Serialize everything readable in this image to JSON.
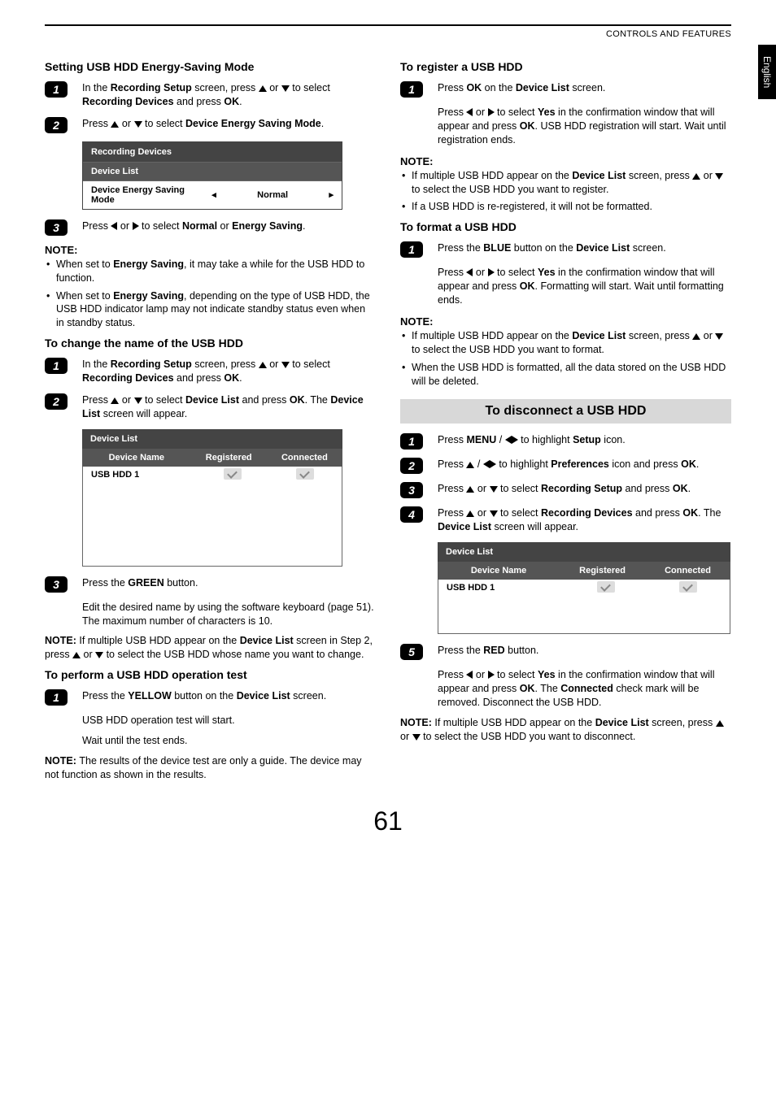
{
  "header": {
    "section": "CONTROLS AND FEATURES",
    "language_tab": "English",
    "page_number": "61"
  },
  "left": {
    "s1_title": "Setting USB HDD Energy-Saving Mode",
    "s1_step1_a": "In the ",
    "s1_step1_b": "Recording Setup",
    "s1_step1_c": " screen, press ",
    "s1_step1_d": " or ",
    "s1_step1_e": " to select ",
    "s1_step1_f": "Recording Devices",
    "s1_step1_g": " and press ",
    "s1_step1_h": "OK",
    "s1_step1_i": ".",
    "s1_step2_a": "Press ",
    "s1_step2_b": " or ",
    "s1_step2_c": " to select ",
    "s1_step2_d": "Device Energy Saving Mode",
    "s1_step2_e": ".",
    "osd1": {
      "title": "Recording Devices",
      "row1": "Device List",
      "row2_name": "Device Energy Saving Mode",
      "row2_value": "Normal"
    },
    "s1_step3_a": "Press ",
    "s1_step3_b": " or ",
    "s1_step3_c": " to select ",
    "s1_step3_d": "Normal",
    "s1_step3_e": " or ",
    "s1_step3_f": "Energy Saving",
    "s1_step3_g": ".",
    "s1_note_title": "NOTE:",
    "s1_note1_a": "When set to ",
    "s1_note1_b": "Energy Saving",
    "s1_note1_c": ", it may take a while for the USB HDD to function.",
    "s1_note2_a": "When set to ",
    "s1_note2_b": "Energy Saving",
    "s1_note2_c": ", depending on the type of USB HDD, the USB HDD indicator lamp may not indicate standby status even when in standby status.",
    "s2_title": "To change the name of the USB HDD",
    "s2_step1_a": "In the ",
    "s2_step1_b": "Recording Setup",
    "s2_step1_c": " screen, press ",
    "s2_step1_d": " or ",
    "s2_step1_e": " to select ",
    "s2_step1_f": "Recording Devices",
    "s2_step1_g": " and press ",
    "s2_step1_h": "OK",
    "s2_step1_i": ".",
    "s2_step2_a": "Press ",
    "s2_step2_b": " or ",
    "s2_step2_c": " to select ",
    "s2_step2_d": "Device List",
    "s2_step2_e": " and press ",
    "s2_step2_f": "OK",
    "s2_step2_g": ". The ",
    "s2_step2_h": "Device List",
    "s2_step2_i": " screen will appear.",
    "dl1": {
      "title": "Device List",
      "col1": "Device Name",
      "col2": "Registered",
      "col3": "Connected",
      "row1_name": "USB HDD 1"
    },
    "s2_step3_a": "Press the ",
    "s2_step3_b": "GREEN",
    "s2_step3_c": " button.",
    "s2_step3_p2": "Edit the desired name by using the software keyboard (page 51). The maximum number of characters is 10.",
    "s2_note_a": "NOTE: ",
    "s2_note_b": "If multiple USB HDD appear on the ",
    "s2_note_c": "Device List",
    "s2_note_d": " screen in Step 2, press ",
    "s2_note_e": " or ",
    "s2_note_f": " to select the USB HDD whose name you want to change.",
    "s3_title": "To perform a USB HDD operation test",
    "s3_step1_a": "Press the ",
    "s3_step1_b": "YELLOW",
    "s3_step1_c": " button on the ",
    "s3_step1_d": "Device List",
    "s3_step1_e": " screen.",
    "s3_step1_p2": "USB HDD operation test will start.",
    "s3_step1_p3": "Wait until the test ends.",
    "s3_note_a": "NOTE: ",
    "s3_note_b": "The results of the device test are only a guide. The device may not function as shown in the results."
  },
  "right": {
    "s4_title": "To register a USB HDD",
    "s4_step1_a": "Press ",
    "s4_step1_b": "OK",
    "s4_step1_c": " on the ",
    "s4_step1_d": "Device List",
    "s4_step1_e": " screen.",
    "s4_step1_p2_a": "Press ",
    "s4_step1_p2_b": " or ",
    "s4_step1_p2_c": " to select ",
    "s4_step1_p2_d": "Yes",
    "s4_step1_p2_e": " in the confirmation window that will appear and press ",
    "s4_step1_p2_f": "OK",
    "s4_step1_p2_g": ". USB HDD registration will start. Wait until registration ends.",
    "s4_note_title": "NOTE:",
    "s4_note1_a": "If multiple USB HDD appear on the ",
    "s4_note1_b": "Device List",
    "s4_note1_c": " screen, press ",
    "s4_note1_d": " or ",
    "s4_note1_e": " to select the USB HDD you want to register.",
    "s4_note2": "If a USB HDD is re-registered, it will not be formatted.",
    "s5_title": "To format a USB HDD",
    "s5_step1_a": "Press the ",
    "s5_step1_b": "BLUE",
    "s5_step1_c": " button on the ",
    "s5_step1_d": "Device List",
    "s5_step1_e": " screen.",
    "s5_step1_p2_a": "Press ",
    "s5_step1_p2_b": " or ",
    "s5_step1_p2_c": " to select ",
    "s5_step1_p2_d": "Yes",
    "s5_step1_p2_e": " in the confirmation window that will appear and press ",
    "s5_step1_p2_f": "OK",
    "s5_step1_p2_g": ". Formatting will start. Wait until formatting ends.",
    "s5_note_title": "NOTE:",
    "s5_note1_a": "If multiple USB HDD appear on the ",
    "s5_note1_b": "Device List",
    "s5_note1_c": " screen, press ",
    "s5_note1_d": " or ",
    "s5_note1_e": " to select the USB HDD you want to format.",
    "s5_note2": "When the USB HDD is formatted, all the data stored on the USB HDD will be deleted.",
    "banner": "To disconnect a USB HDD",
    "s6_step1_a": "Press ",
    "s6_step1_b": "MENU",
    "s6_step1_c": " / ",
    "s6_step1_d": " to highlight ",
    "s6_step1_e": "Setup",
    "s6_step1_f": " icon.",
    "s6_step2_a": "Press ",
    "s6_step2_b": " / ",
    "s6_step2_c": " to highlight ",
    "s6_step2_d": "Preferences",
    "s6_step2_e": " icon and press ",
    "s6_step2_f": "OK",
    "s6_step2_g": ".",
    "s6_step3_a": "Press ",
    "s6_step3_b": " or ",
    "s6_step3_c": " to select ",
    "s6_step3_d": "Recording Setup",
    "s6_step3_e": " and press ",
    "s6_step3_f": "OK",
    "s6_step3_g": ".",
    "s6_step4_a": "Press ",
    "s6_step4_b": " or ",
    "s6_step4_c": " to select ",
    "s6_step4_d": "Recording Devices",
    "s6_step4_e": " and press ",
    "s6_step4_f": "OK",
    "s6_step4_g": ". The ",
    "s6_step4_h": "Device List",
    "s6_step4_i": " screen will appear.",
    "dl2": {
      "title": "Device List",
      "col1": "Device Name",
      "col2": "Registered",
      "col3": "Connected",
      "row1_name": "USB HDD 1"
    },
    "s6_step5_a": "Press the ",
    "s6_step5_b": "RED",
    "s6_step5_c": " button.",
    "s6_step5_p2_a": "Press ",
    "s6_step5_p2_b": " or ",
    "s6_step5_p2_c": " to select ",
    "s6_step5_p2_d": "Yes",
    "s6_step5_p2_e": " in the confirmation window that will appear and press ",
    "s6_step5_p2_f": "OK",
    "s6_step5_p2_g": ". The ",
    "s6_step5_p2_h": "Connected",
    "s6_step5_p2_i": " check mark will be removed. Disconnect the USB HDD.",
    "s6_note_a": "NOTE: ",
    "s6_note_b": "If multiple USB HDD appear on the ",
    "s6_note_c": "Device List",
    "s6_note_d": " screen, press ",
    "s6_note_e": " or ",
    "s6_note_f": " to select the USB HDD you want to disconnect."
  }
}
